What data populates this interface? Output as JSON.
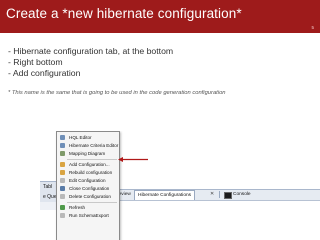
{
  "slide": {
    "title": "Create a *new hibernate configuration*",
    "page_number": "5"
  },
  "bullets": [
    "- Hibernate configuration tab, at the bottom",
    "- Right bottom",
    "- Add configuration"
  ],
  "note": "* This name is the same that is going to be used in the  code generation configuration",
  "screenshot": {
    "context_menu": [
      {
        "label": "HQL Editor",
        "icon": "hql-editor-icon",
        "color": "#6f8fb8"
      },
      {
        "label": "Hibernate Criteria Editor",
        "icon": "criteria-editor-icon",
        "color": "#6f8fb8"
      },
      {
        "label": "Mapping Diagram",
        "icon": "mapping-diagram-icon",
        "color": "#7f9a6a"
      },
      {
        "label": "Add Configuration...",
        "icon": "add-configuration-icon",
        "color": "#d9a441"
      },
      {
        "label": "Rebuild configuration",
        "icon": "rebuild-icon",
        "color": "#d9a441"
      },
      {
        "label": "Edit Configuration",
        "icon": "edit-icon",
        "color": "#b9b9b9"
      },
      {
        "label": "Close Configuration",
        "icon": "close-configuration-icon",
        "color": "#5a7ca8"
      },
      {
        "label": "Delete Configuration",
        "icon": "delete-icon",
        "color": "#b9b9b9"
      },
      {
        "label": "Refresh",
        "icon": "refresh-icon",
        "color": "#4f9a4a"
      },
      {
        "label": "Run SchemaExport",
        "icon": "schema-export-icon",
        "color": "#b9b9b9"
      }
    ],
    "left_tabs": [
      "Tabl",
      "e Que"
    ],
    "bottom_bar": {
      "preview_label": "review",
      "hibernate_tab": "Hibernate Configurations",
      "close_glyph": "✕",
      "console_tab": "Console"
    }
  },
  "colors": {
    "title_bar": "#9e1b1b",
    "arrow": "#b01919"
  }
}
